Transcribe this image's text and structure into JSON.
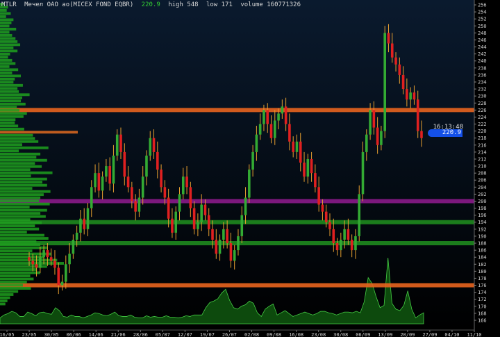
{
  "header": {
    "ticker": "MTLR",
    "instrument": "Мечел ОАО ао(MICEX FOND EQBR)",
    "last": "220.9",
    "high": "high 548",
    "low": "low 171",
    "volume": "volume 160771326"
  },
  "current": {
    "time": "16:13:48",
    "price": "220.9"
  },
  "colors": {
    "bull": "#33aa33",
    "bear": "#e02020",
    "wick": "#e8a030",
    "volume_fill": "#0d4a0d",
    "volume_line": "#44cc44",
    "profile": "#1fa01f",
    "profile_hl": "#e06a20"
  },
  "chart_data": {
    "type": "candlestick",
    "ylim": [
      165,
      257
    ],
    "y_ticks": [
      166,
      168,
      170,
      172,
      174,
      176,
      178,
      180,
      182,
      184,
      186,
      188,
      190,
      192,
      194,
      196,
      198,
      200,
      202,
      204,
      206,
      208,
      210,
      212,
      214,
      216,
      218,
      220,
      222,
      224,
      226,
      228,
      230,
      232,
      234,
      236,
      238,
      240,
      242,
      244,
      246,
      248,
      250,
      252,
      254,
      256
    ],
    "x_ticks": [
      "16/05",
      "23/05",
      "30/05",
      "06/06",
      "14/06",
      "21/06",
      "28/06",
      "05/07",
      "12/07",
      "19/07",
      "26/07",
      "02/08",
      "09/08",
      "16/08",
      "23/08",
      "30/08",
      "06/09",
      "13/09",
      "20/09",
      "27/09",
      "04/10",
      "11/10"
    ],
    "levels": [
      {
        "price": 226,
        "label": "226",
        "color": "#e8641e"
      },
      {
        "price": 200,
        "label": "200",
        "color": "#8a1a8a"
      },
      {
        "price": 194,
        "label": "194",
        "color": "#1e8a1e"
      },
      {
        "price": 188,
        "label": "188",
        "color": "#1e8a1e"
      },
      {
        "price": 176,
        "label": "176",
        "color": "#e8641e"
      }
    ],
    "daily_close": [
      183,
      182,
      181,
      184,
      186,
      184,
      183,
      181,
      176,
      177,
      182,
      185,
      189,
      191,
      195,
      192,
      198,
      204,
      208,
      203,
      207,
      210,
      205,
      213,
      219,
      214,
      207,
      204,
      200,
      197,
      201,
      207,
      213,
      218,
      214,
      209,
      204,
      201,
      195,
      191,
      197,
      202,
      207,
      204,
      198,
      192,
      194,
      199,
      196,
      192,
      189,
      185,
      189,
      192,
      188,
      183,
      186,
      190,
      196,
      201,
      209,
      214,
      219,
      222,
      226,
      222,
      218,
      223,
      225,
      227,
      222,
      217,
      214,
      217,
      211,
      207,
      212,
      208,
      204,
      199,
      197,
      194,
      192,
      188,
      186,
      189,
      192,
      189,
      186,
      190,
      202,
      214,
      219,
      226,
      221,
      216,
      220,
      248,
      245,
      241,
      239,
      236,
      232,
      229,
      231,
      229,
      220,
      218
    ],
    "volume_profile": [
      6,
      12,
      10,
      16,
      9,
      20,
      17,
      14,
      24,
      14,
      18,
      23,
      26,
      30,
      20,
      26,
      15,
      12,
      18,
      23,
      14,
      27,
      18,
      31,
      22,
      20,
      34,
      26,
      28,
      44,
      33,
      31,
      38,
      25,
      29,
      40,
      35,
      23,
      22,
      27,
      36,
      43,
      49,
      52,
      57,
      33,
      72,
      28,
      60,
      54,
      70,
      52,
      62,
      45,
      78,
      46,
      70,
      63,
      70,
      48,
      75,
      65,
      60,
      58,
      74,
      44,
      70,
      60,
      68,
      45,
      62,
      52,
      58,
      40,
      66,
      72,
      54,
      60,
      70,
      48,
      76,
      65,
      85,
      95,
      70,
      55,
      60,
      45,
      50,
      40,
      34,
      46,
      27,
      20,
      15,
      11,
      8
    ],
    "volume_series": [
      8,
      12,
      14,
      17,
      15,
      10,
      10,
      16,
      14,
      11,
      15,
      16,
      14,
      13,
      22,
      18,
      10,
      9,
      12,
      10,
      10,
      8,
      10,
      12,
      15,
      14,
      12,
      11,
      13,
      16,
      11,
      10,
      10,
      12,
      9,
      8,
      8,
      11,
      9,
      10,
      9,
      9,
      11,
      9,
      9,
      8,
      9,
      11,
      10,
      12,
      12,
      12,
      22,
      29,
      31,
      34,
      42,
      47,
      32,
      22,
      20,
      24,
      26,
      31,
      28,
      15,
      10,
      20,
      24,
      27,
      12,
      15,
      18,
      14,
      10,
      12,
      14,
      16,
      14,
      12,
      14,
      17,
      17,
      15,
      14,
      12,
      14,
      16,
      16,
      15,
      17,
      15,
      30,
      63,
      55,
      37,
      22,
      25,
      90,
      28,
      20,
      18,
      25,
      45,
      20,
      8,
      12,
      15
    ]
  }
}
